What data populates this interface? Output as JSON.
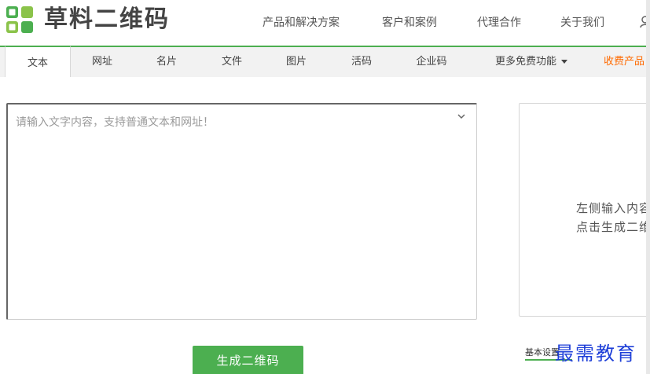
{
  "brand": {
    "name": "草料二维码",
    "logo_color": "#4caf50"
  },
  "topnav": {
    "items": [
      "产品和解决方案",
      "客户和案例",
      "代理合作",
      "关于我们"
    ]
  },
  "tabs": {
    "items": [
      "文本",
      "网址",
      "名片",
      "文件",
      "图片",
      "活码",
      "企业码",
      "更多免费功能",
      "收费产品"
    ],
    "active": "文本"
  },
  "editor": {
    "placeholder": "请输入文字内容，支持普通文本和网址！",
    "value": ""
  },
  "result": {
    "line1": "左侧输入内容",
    "line2": "点击生成二维码"
  },
  "actions": {
    "generate_label": "生成二维码"
  },
  "bottom_tab": {
    "label": "基本设置"
  },
  "watermark": {
    "text": "最需教育"
  },
  "colors": {
    "accent": "#4caf50",
    "paid": "#ff6a00"
  }
}
